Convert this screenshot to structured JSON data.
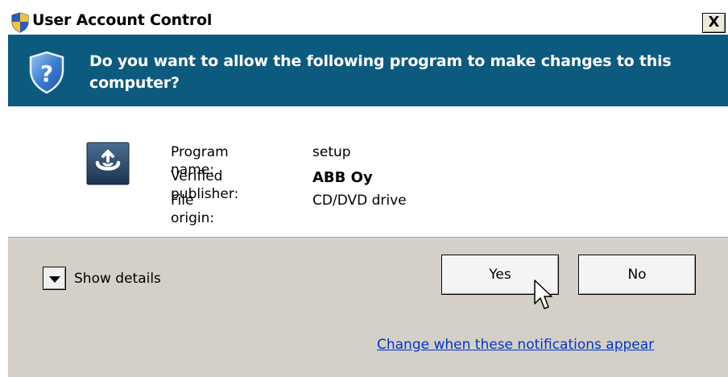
{
  "window": {
    "title": "User Account Control",
    "close_label": "X"
  },
  "banner": {
    "question": "Do you want to allow the following program to make changes to this computer?"
  },
  "program": {
    "name_label": "Program name:",
    "name_value": "setup",
    "publisher_label": "Verified publisher:",
    "publisher_value": "ABB Oy",
    "origin_label": "File origin:",
    "origin_value": "CD/DVD drive"
  },
  "footer": {
    "show_details_label": "Show details",
    "yes_label": "Yes",
    "no_label": "No",
    "notifications_link": "Change when these notifications appear"
  },
  "icons": {
    "title": "uac-shield-icon",
    "banner": "question-shield-icon",
    "program": "setup-program-icon",
    "toggle": "chevron-down-icon",
    "pointer": "mouse-cursor-icon"
  },
  "colors": {
    "banner_bg": "#0d5a7f",
    "footer_bg": "#d4d0c8",
    "link": "#0033cc"
  }
}
